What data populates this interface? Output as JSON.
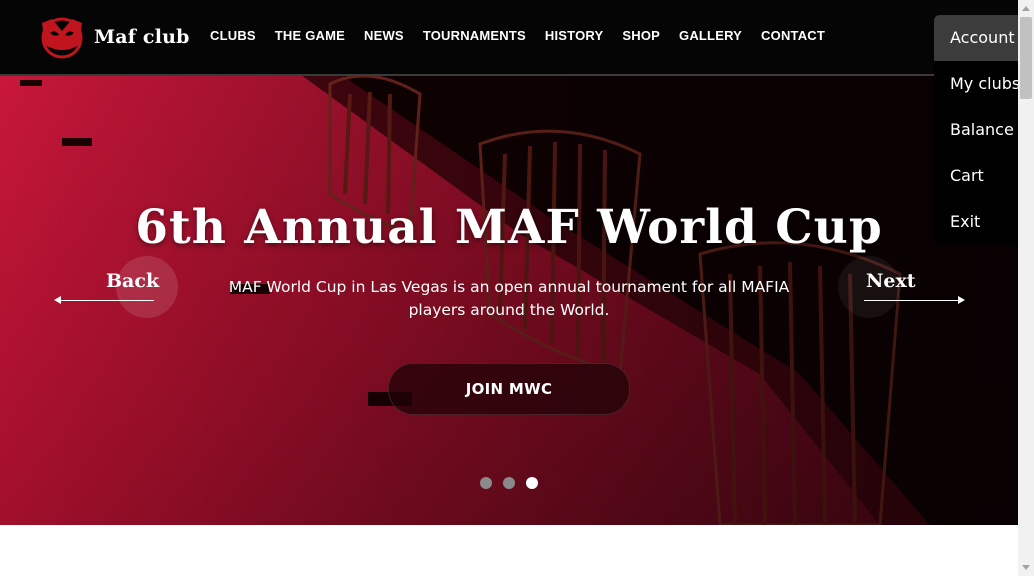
{
  "brand": {
    "name": "Maf club",
    "logo_icon": "maf-mask-logo-icon",
    "logo_color": "#c0141f"
  },
  "nav": [
    "CLUBS",
    "THE GAME",
    "NEWS",
    "TOURNAMENTS",
    "HISTORY",
    "SHOP",
    "GALLERY",
    "CONTACT"
  ],
  "account_menu": [
    "Account",
    "My clubs",
    "Balance",
    "Cart",
    "Exit"
  ],
  "hero": {
    "title": "6th Annual MAF World Cup",
    "subtitle": "MAF World Cup in Las Vegas is an open annual tournament for all MAFIA players around the World.",
    "cta": "JOIN MWC",
    "back_label": "Back",
    "next_label": "Next",
    "slide_count": 3,
    "active_slide": 3,
    "accent": "#b0102c"
  }
}
